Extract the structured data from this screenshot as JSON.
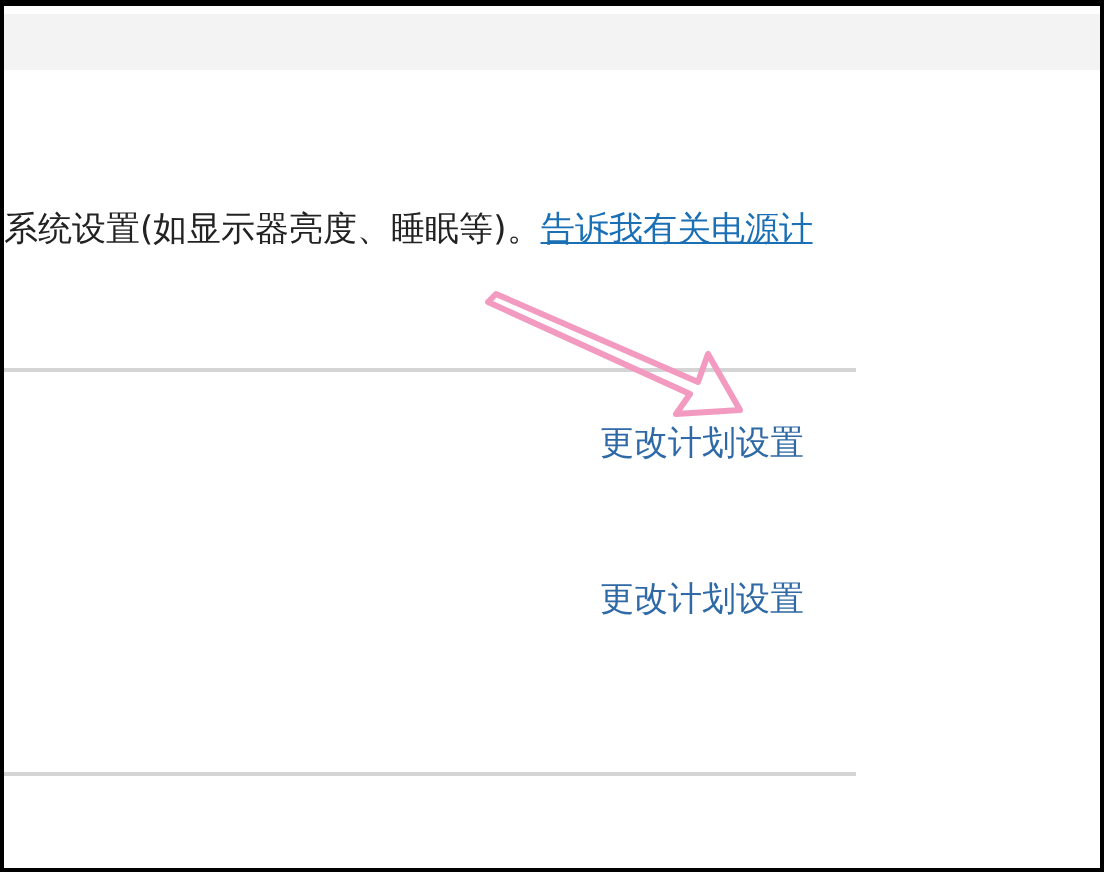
{
  "description": {
    "text": "系统设置(如显示器亮度、睡眠等)。",
    "link": "告诉我有关电源计"
  },
  "plans": [
    {
      "link": "更改计划设置"
    },
    {
      "link": "更改计划设置"
    }
  ],
  "annotation": {
    "kind": "arrow"
  }
}
